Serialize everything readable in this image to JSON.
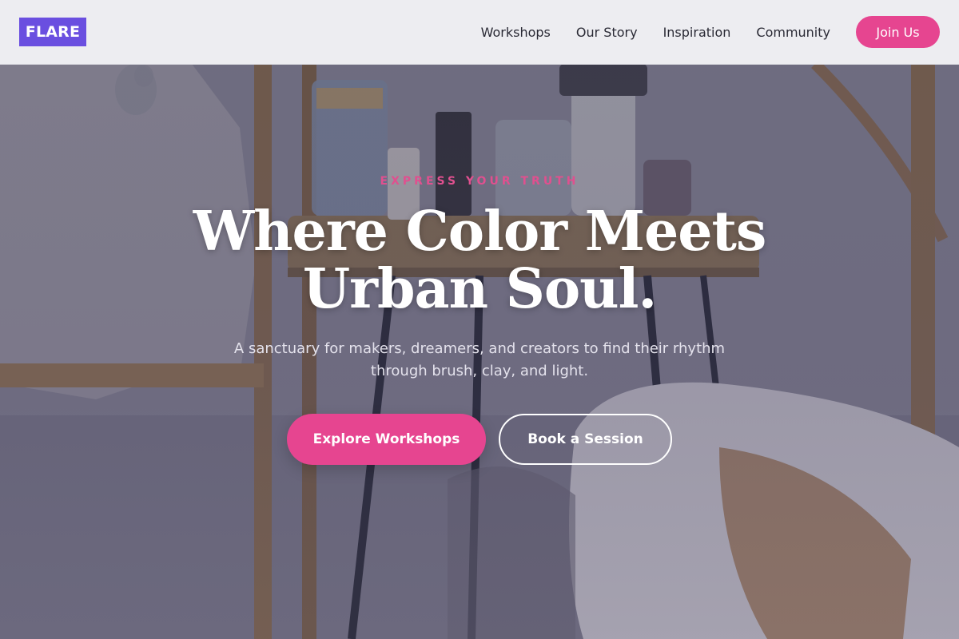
{
  "header": {
    "logo": "FLARE",
    "nav": [
      {
        "label": "Workshops"
      },
      {
        "label": "Our Story"
      },
      {
        "label": "Inspiration"
      },
      {
        "label": "Community"
      }
    ],
    "cta": "Join Us"
  },
  "hero": {
    "eyebrow": "EXPRESS YOUR TRUTH",
    "headline_line1": "Where Color Meets",
    "headline_line2": "Urban Soul.",
    "subtitle": "A sanctuary for makers, dreamers, and creators to find their rhythm through brush, clay, and light.",
    "primary_button": "Explore Workshops",
    "secondary_button": "Book a Session",
    "background_image": "art-studio-supplies-photo"
  },
  "colors": {
    "brand_purple": "#6a4fe0",
    "accent_pink": "#e64590",
    "eyebrow_pink": "#e0508f",
    "header_bg": "#f3f3f6",
    "nav_text": "#2a2a35",
    "headline_text": "#ffffff"
  }
}
